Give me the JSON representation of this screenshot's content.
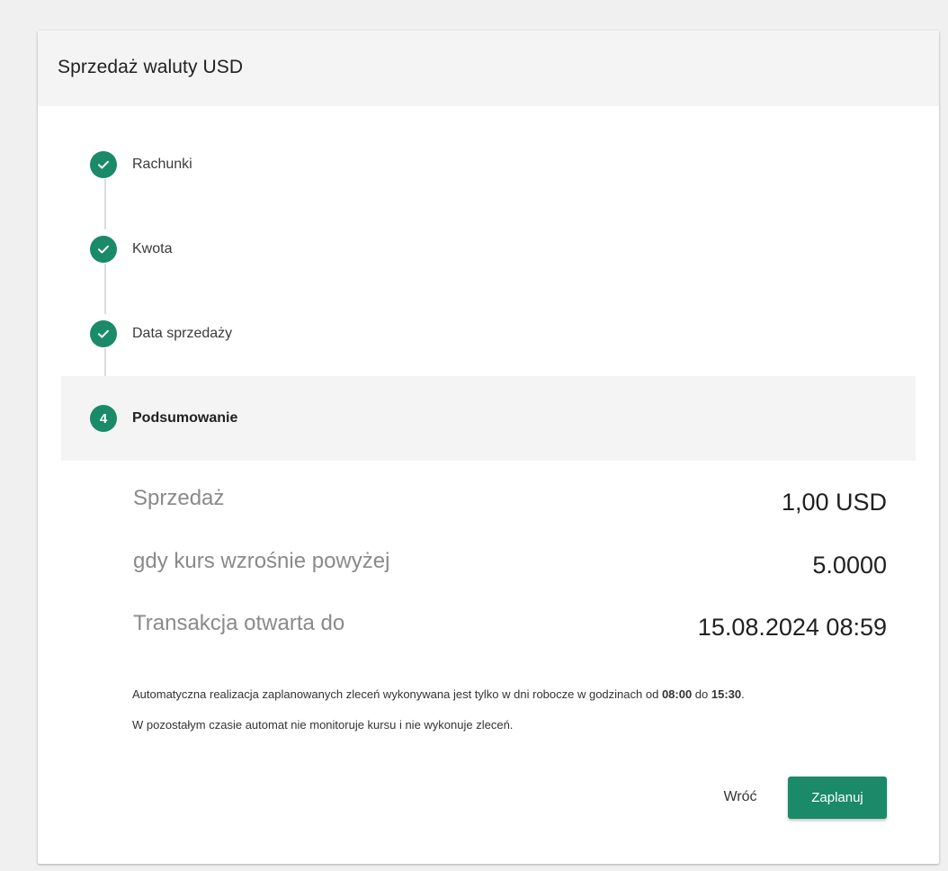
{
  "header": {
    "title": "Sprzedaż waluty USD"
  },
  "steps": [
    {
      "label": "Rachunki",
      "status": "completed",
      "icon": "check-icon"
    },
    {
      "label": "Kwota",
      "status": "completed",
      "icon": "check-icon"
    },
    {
      "label": "Data sprzedaży",
      "status": "completed",
      "icon": "check-icon"
    },
    {
      "label": "Podsumowanie",
      "status": "active",
      "number": "4"
    }
  ],
  "summary": {
    "rows": [
      {
        "label": "Sprzedaż",
        "value": "1,00 USD"
      },
      {
        "label": "gdy kurs wzrośnie powyżej",
        "value": "5.0000"
      },
      {
        "label": "Transakcja otwarta do",
        "value": "15.08.2024 08:59"
      }
    ]
  },
  "info": {
    "line1_prefix": "Automatyczna realizacja zaplanowanych zleceń wykonywana jest tylko w dni robocze w godzinach od ",
    "time_from": "08:00",
    "line1_mid": " do ",
    "time_to": "15:30",
    "line1_suffix": ".",
    "line2": "W pozostałym czasie automat nie monitoruje kursu i nie wykonuje zleceń."
  },
  "actions": {
    "back_label": "Wróć",
    "submit_label": "Zaplanuj"
  },
  "colors": {
    "accent": "#1a8a68",
    "page_background": "#f0f0f0",
    "header_background": "#f4f4f4",
    "active_step_background": "#f4f4f4",
    "muted_text": "#8a8a8a"
  }
}
